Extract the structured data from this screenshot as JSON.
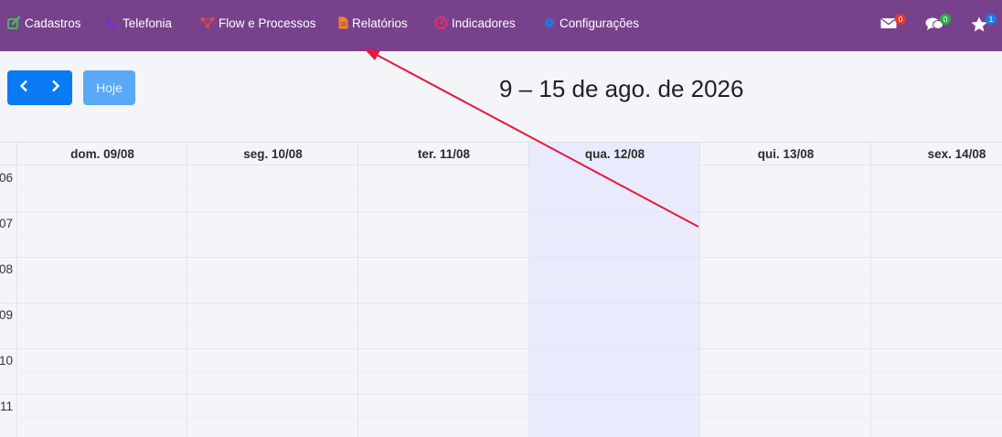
{
  "topnav": {
    "items": [
      {
        "label": "Cadastros",
        "icon": "edit-icon",
        "color": "#3ec25b"
      },
      {
        "label": "Telefonia",
        "icon": "phone-icon",
        "color": "#6a2cf0"
      },
      {
        "label": "Flow e Processos",
        "icon": "flow-icon",
        "color": "#e4453f"
      },
      {
        "label": "Relatórios",
        "icon": "file-icon",
        "color": "#f5822a"
      },
      {
        "label": "Indicadores",
        "icon": "gauge-icon",
        "color": "#e22f6b"
      },
      {
        "label": "Configurações",
        "icon": "gear-icon",
        "color": "#1e7be6"
      }
    ],
    "notifications": {
      "mail_count": "0",
      "chat_count": "0",
      "star_count": "1"
    }
  },
  "calendar": {
    "today_label": "Hoje",
    "title": "9 – 15 de ago. de 2026",
    "days": [
      "dom. 09/08",
      "seg. 10/08",
      "ter. 11/08",
      "qua. 12/08",
      "qui. 13/08",
      "sex. 14/08"
    ],
    "today_index": 3,
    "hours": [
      "06",
      "07",
      "08",
      "09",
      "10",
      "11"
    ]
  },
  "colors": {
    "topbar": "#77418c",
    "primary": "#0a7bf5",
    "today_column": "#e9ebfd",
    "annotation_arrow": "#e8173f"
  }
}
